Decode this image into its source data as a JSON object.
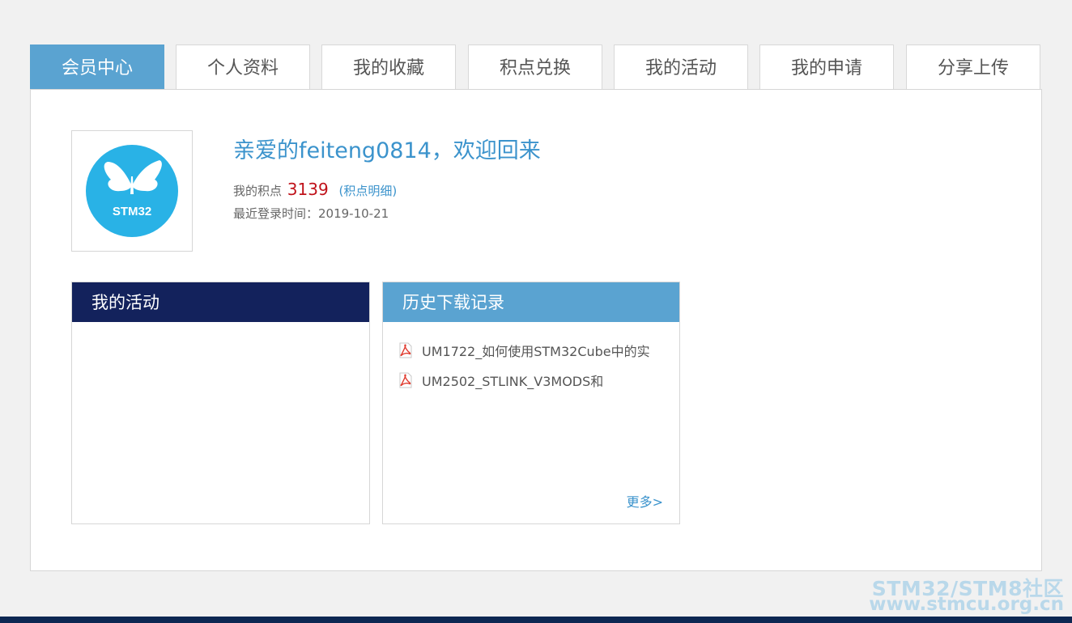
{
  "tabs": [
    {
      "label": "会员中心",
      "active": true
    },
    {
      "label": "个人资料",
      "active": false
    },
    {
      "label": "我的收藏",
      "active": false
    },
    {
      "label": "积点兑换",
      "active": false
    },
    {
      "label": "我的活动",
      "active": false
    },
    {
      "label": "我的申请",
      "active": false
    },
    {
      "label": "分享上传",
      "active": false
    }
  ],
  "profile": {
    "avatar_icon": "stm32-butterfly-logo",
    "avatar_text": "STM32",
    "welcome": "亲爱的feiteng0814，欢迎回来",
    "points_label": "我的积点",
    "points_value": "3139",
    "points_paren_open": "(",
    "points_link": "积点明细",
    "points_paren_close": ")",
    "last_login": "最近登录时间：2019-10-21"
  },
  "activity_box": {
    "title": "我的活动"
  },
  "downloads_box": {
    "title": "历史下载记录",
    "items": [
      {
        "icon": "pdf-icon",
        "name": "UM1722_如何使用STM32Cube中的实"
      },
      {
        "icon": "pdf-icon",
        "name": "UM2502_STLINK_V3MODS和"
      }
    ],
    "more": "更多>"
  },
  "watermark": {
    "line1": "STM32/STM8社区",
    "line2": "www.stmcu.org.cn"
  },
  "colors": {
    "tab_active": "#5aa3d1",
    "activity_header": "#13225c",
    "downloads_header": "#5aa3d1",
    "points_value": "#c0121a",
    "link": "#3b93cc",
    "footer_bar": "#0d2752"
  }
}
